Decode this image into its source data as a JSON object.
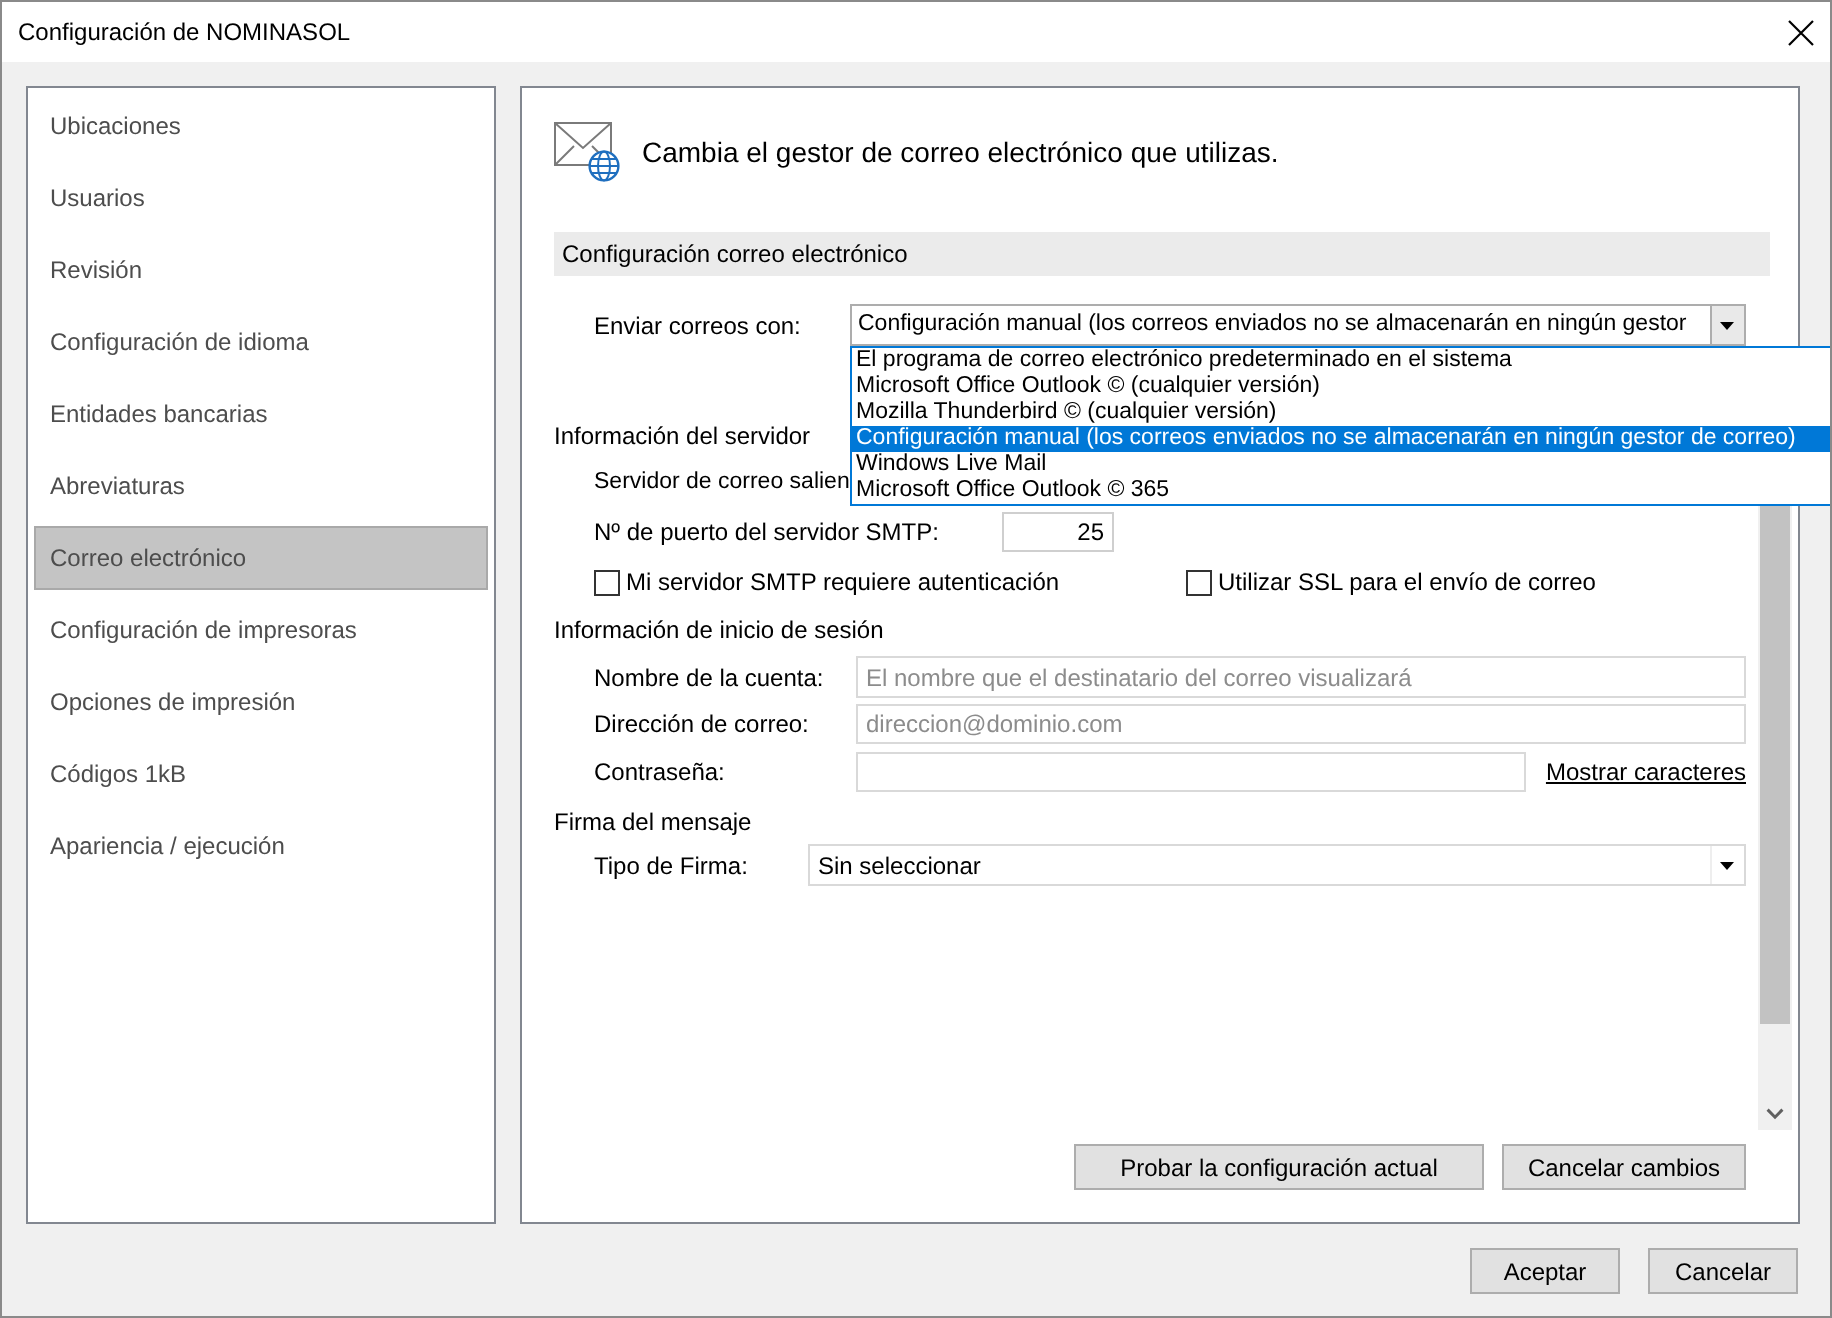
{
  "window": {
    "title": "Configuración de NOMINASOL"
  },
  "sidebar": {
    "items": [
      {
        "label": "Ubicaciones",
        "selected": false
      },
      {
        "label": "Usuarios",
        "selected": false
      },
      {
        "label": "Revisión",
        "selected": false
      },
      {
        "label": "Configuración de idioma",
        "selected": false
      },
      {
        "label": "Entidades bancarias",
        "selected": false
      },
      {
        "label": "Abreviaturas",
        "selected": false
      },
      {
        "label": "Correo electrónico",
        "selected": true
      },
      {
        "label": "Configuración de impresoras",
        "selected": false
      },
      {
        "label": "Opciones de impresión",
        "selected": false
      },
      {
        "label": "Códigos 1kB",
        "selected": false
      },
      {
        "label": "Apariencia / ejecución",
        "selected": false
      }
    ]
  },
  "panel": {
    "heading": "Cambia el gestor de correo electrónico que utilizas.",
    "section_title": "Configuración correo electrónico",
    "send_with": {
      "label": "Enviar correos con:",
      "value": "Configuración manual (los correos enviados no se almacenarán en ningún gestor",
      "expanded": true,
      "options": [
        {
          "label": "El programa de correo electrónico predeterminado en el sistema",
          "selected": false
        },
        {
          "label": "Microsoft Office Outlook © (cualquier versión)",
          "selected": false
        },
        {
          "label": "Mozilla Thunderbird © (cualquier versión)",
          "selected": false
        },
        {
          "label": "Configuración manual (los correos enviados no se almacenarán en ningún gestor de correo)",
          "selected": true
        },
        {
          "label": "Windows Live Mail",
          "selected": false
        },
        {
          "label": "Microsoft Office Outlook © 365",
          "selected": false
        }
      ]
    },
    "server": {
      "title": "Información del servidor",
      "outgoing_label": "Servidor de correo salien",
      "port": {
        "label": "Nº de puerto del servidor SMTP:",
        "value": "25"
      },
      "checkboxes": [
        {
          "label": "Mi servidor SMTP requiere autenticación",
          "checked": false
        },
        {
          "label": "Utilizar SSL para el envío de correo",
          "checked": false
        }
      ]
    },
    "login": {
      "title": "Información de inicio de sesión",
      "fields": [
        {
          "label": "Nombre de la cuenta:",
          "placeholder": "El nombre que el destinatario del correo visualizará"
        },
        {
          "label": "Dirección de correo:",
          "placeholder": "direccion@dominio.com"
        },
        {
          "label": "Contraseña:",
          "link": "Mostrar caracteres"
        }
      ]
    },
    "signature": {
      "title": "Firma del mensaje",
      "type": {
        "label": "Tipo de Firma:",
        "value": "Sin seleccionar"
      }
    },
    "actions": [
      "Probar la configuración actual",
      "Cancelar cambios"
    ]
  },
  "buttons": [
    "Aceptar",
    "Cancelar"
  ]
}
